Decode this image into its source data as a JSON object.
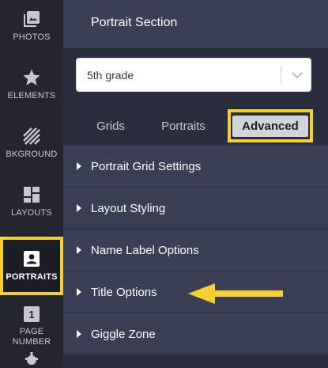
{
  "sidebar": {
    "items": [
      {
        "label": "PHOTOS",
        "icon": "photos-icon",
        "active": false
      },
      {
        "label": "ELEMENTS",
        "icon": "star-icon",
        "active": false
      },
      {
        "label": "BKGROUND",
        "icon": "background-stripes-icon",
        "active": false
      },
      {
        "label": "LAYOUTS",
        "icon": "layouts-icon",
        "active": false
      },
      {
        "label": "PORTRAITS",
        "icon": "portrait-icon",
        "active": true
      },
      {
        "label": "PAGE\nNUMBER",
        "icon": "page-number-icon",
        "badge": "1",
        "active": false
      }
    ]
  },
  "panel": {
    "title": "Portrait Section",
    "select": {
      "value": "5th grade",
      "icon": "chevron-down-icon"
    },
    "tabs": [
      {
        "label": "Grids",
        "active": false
      },
      {
        "label": "Portraits",
        "active": false
      },
      {
        "label": "Advanced",
        "active": true
      }
    ],
    "sections": [
      {
        "label": "Portrait Grid Settings"
      },
      {
        "label": "Layout Styling"
      },
      {
        "label": "Name Label Options"
      },
      {
        "label": "Title Options"
      },
      {
        "label": "Giggle Zone"
      }
    ]
  },
  "annotation": {
    "arrow_color": "#f5d02e",
    "highlight_color": "#f5d02e"
  },
  "colors": {
    "sidebar_bg": "#232631",
    "panel_bg": "#2a2d3d",
    "row_bg": "#3a3f57",
    "accent": "#f5d02e"
  }
}
